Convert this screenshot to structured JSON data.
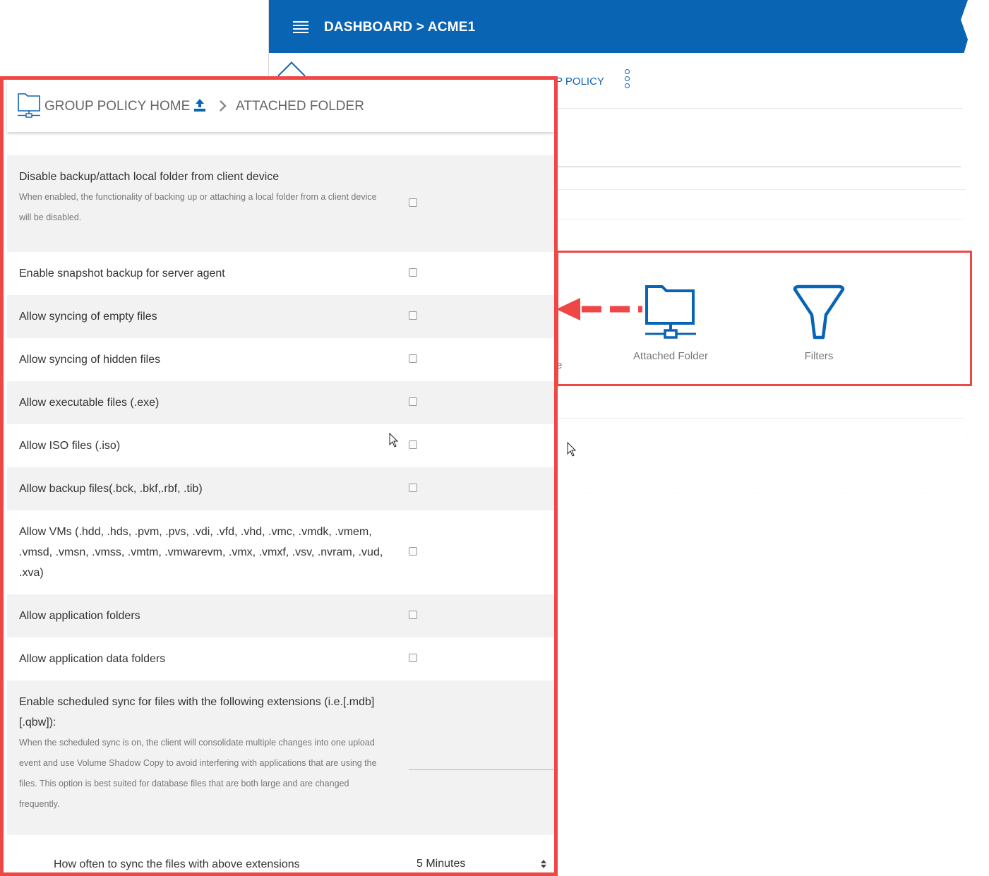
{
  "background_window": {
    "title": "DASHBOARD > ACME1",
    "policy_link": "P POLICY",
    "tiles": {
      "partial_label": "e",
      "attached_folder": "Attached Folder",
      "filters": "Filters"
    }
  },
  "panel": {
    "breadcrumb": {
      "home": "GROUP POLICY HOME",
      "current": "ATTACHED FOLDER"
    },
    "settings": [
      {
        "label": "Disable backup/attach local folder from client device",
        "desc": "When enabled, the functionality of backing up or attaching a local folder from a client device will be disabled.",
        "checked": false
      },
      {
        "label": "Enable snapshot backup for server agent",
        "checked": false
      },
      {
        "label": "Allow syncing of empty files",
        "checked": false
      },
      {
        "label": "Allow syncing of hidden files",
        "checked": false
      },
      {
        "label": "Allow executable files (.exe)",
        "checked": false
      },
      {
        "label": "Allow ISO files (.iso)",
        "checked": false
      },
      {
        "label": "Allow backup files(.bck, .bkf,.rbf, .tib)",
        "checked": false
      },
      {
        "label": "Allow VMs (.hdd, .hds, .pvm, .pvs, .vdi, .vfd, .vhd, .vmc, .vmdk, .vmem, .vmsd, .vmsn, .vmss, .vmtm, .vmwarevm, .vmx, .vmxf, .vsv, .nvram, .vud, .xva)",
        "checked": false
      },
      {
        "label": "Allow application folders",
        "checked": false
      },
      {
        "label": "Allow application data folders",
        "checked": false
      },
      {
        "label": "Enable scheduled sync for files with the following extensions (i.e.[.mdb][.qbw]):",
        "desc": "When the scheduled sync is on, the client will consolidate multiple changes into one upload event and use Volume Shadow Copy to avoid interfering with applications that are using the files. This option is best suited for database files that are both large and are changed frequently.",
        "value": ""
      }
    ],
    "frequency": {
      "label": "How often to sync the files with above extensions",
      "selected": "5 Minutes"
    }
  },
  "colors": {
    "brand_blue": "#0a64b4",
    "highlight_red": "#ef4646"
  }
}
